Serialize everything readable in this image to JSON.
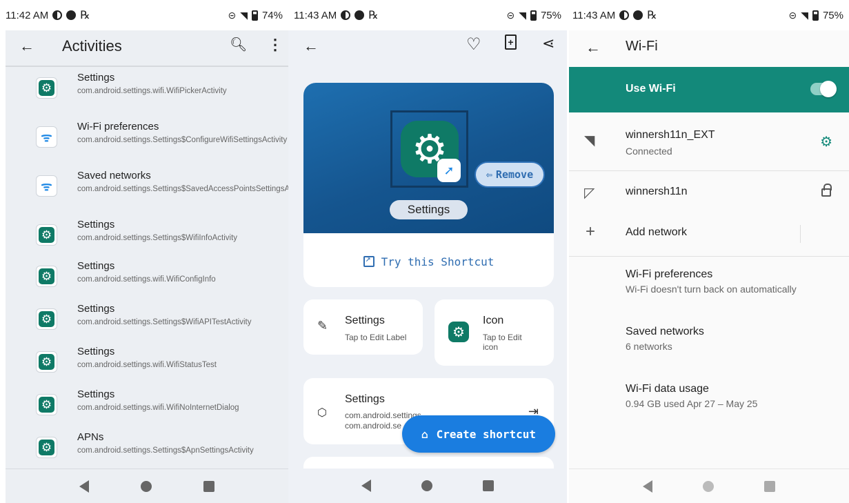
{
  "screen1": {
    "status": {
      "time": "11:42 AM",
      "battery": "74%"
    },
    "title": "Activities",
    "activities": [
      {
        "name": "Settings",
        "cls": "com.android.settings.wifi.WifiPickerActivity",
        "icon": "gear-icon"
      },
      {
        "name": "Wi-Fi preferences",
        "cls": "com.android.settings.Settings$ConfigureWifiSettingsActivity",
        "icon": "wifi-icon"
      },
      {
        "name": "Saved networks",
        "cls": "com.android.settings.Settings$SavedAccessPointsSettingsActivity",
        "icon": "wifi-icon"
      },
      {
        "name": "Settings",
        "cls": "com.android.settings.Settings$WifiInfoActivity",
        "icon": "gear-icon"
      },
      {
        "name": "Settings",
        "cls": "com.android.settings.wifi.WifiConfigInfo",
        "icon": "gear-icon"
      },
      {
        "name": "Settings",
        "cls": "com.android.settings.Settings$WifiAPITestActivity",
        "icon": "gear-icon"
      },
      {
        "name": "Settings",
        "cls": "com.android.settings.wifi.WifiStatusTest",
        "icon": "gear-icon"
      },
      {
        "name": "Settings",
        "cls": "com.android.settings.wifi.WifiNoInternetDialog",
        "icon": "gear-icon"
      },
      {
        "name": "APNs",
        "cls": "com.android.settings.Settings$ApnSettingsActivity",
        "icon": "gear-icon"
      }
    ]
  },
  "screen2": {
    "status": {
      "time": "11:43 AM",
      "battery": "75%"
    },
    "hero_label": "Settings",
    "remove_label": "Remove",
    "try_label": "Try this Shortcut",
    "label_card": {
      "title": "Settings",
      "sub": "Tap to Edit Label"
    },
    "icon_card": {
      "title": "Icon",
      "sub": "Tap to Edit icon"
    },
    "activity_card": {
      "title": "Settings",
      "line1": "com.android.settings",
      "line2": "com.android.se"
    },
    "fab_label": "Create shortcut"
  },
  "screen3": {
    "status": {
      "time": "11:43 AM",
      "battery": "75%"
    },
    "title": "Wi-Fi",
    "use_wifi": "Use Wi-Fi",
    "networks": [
      {
        "name": "winnersh11n_EXT",
        "sub": "Connected"
      },
      {
        "name": "winnersh11n"
      }
    ],
    "add_network": "Add network",
    "prefs": [
      {
        "title": "Wi-Fi preferences",
        "sub": "Wi-Fi doesn't turn back on automatically"
      },
      {
        "title": "Saved networks",
        "sub": "6 networks"
      },
      {
        "title": "Wi-Fi data usage",
        "sub": "0.94 GB used Apr 27 – May 25"
      }
    ]
  },
  "colors": {
    "accent_teal": "#13897a",
    "accent_blue": "#1a7de0",
    "app_green": "#0f7a66"
  }
}
